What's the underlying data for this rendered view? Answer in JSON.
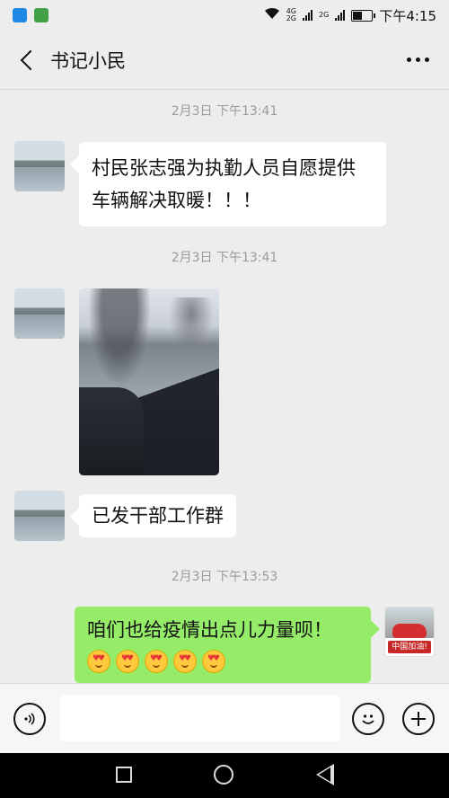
{
  "status_bar": {
    "time": "下午4:15",
    "network_1": "4G",
    "network_2": "2G",
    "network_3": "2G"
  },
  "header": {
    "title": "书记小民"
  },
  "messages": [
    {
      "timestamp": "2月3日 下午13:41",
      "type": "text",
      "side": "left",
      "text": "村民张志强为执勤人员自愿提供车辆解决取暖！！！"
    },
    {
      "timestamp": "2月3日 下午13:41",
      "type": "image",
      "side": "left"
    },
    {
      "type": "text",
      "side": "left",
      "text": "已发干部工作群"
    },
    {
      "timestamp": "2月3日 下午13:53",
      "type": "text",
      "side": "right",
      "text": "咱们也给疫情出点儿力量呗！"
    }
  ],
  "self_avatar_label": "中国加油!",
  "emoji_name": "heart-eyes-emoji",
  "input_bar": {
    "placeholder": ""
  },
  "colors": {
    "background": "#ededed",
    "bubble_white": "#ffffff",
    "bubble_green": "#95ec69",
    "timestamp": "#9b9b9b"
  }
}
